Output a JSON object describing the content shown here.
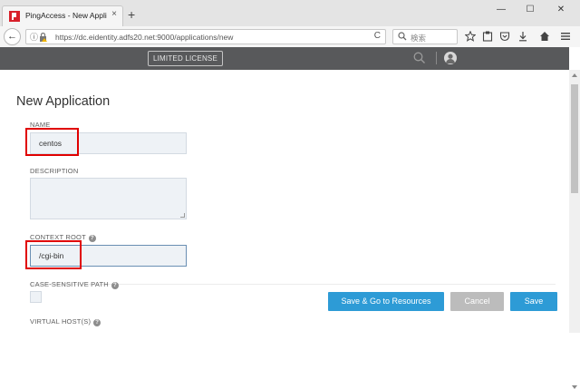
{
  "browser": {
    "tab_title": "PingAccess - New Applica...",
    "url": "https://dc.eidentity.adfs20.net:9000/applications/new",
    "search_placeholder": "検索",
    "tab_close": "×",
    "new_tab": "+",
    "win_min": "—",
    "win_max": "☐",
    "win_close": "✕",
    "back": "←",
    "info": "ⓘ",
    "reload": "C"
  },
  "app": {
    "license_label": "LIMITED LICENSE"
  },
  "form": {
    "title": "New Application",
    "name_label": "NAME",
    "name_value": "centos",
    "description_label": "DESCRIPTION",
    "context_root_label": "CONTEXT ROOT",
    "context_root_value": "/cgi-bin",
    "case_sensitive_label": "CASE-SENSITIVE PATH",
    "virtual_hosts_label": "VIRTUAL HOST(S)",
    "help_glyph": "?"
  },
  "actions": {
    "save_resources_label": "Save & Go to Resources",
    "cancel_label": "Cancel",
    "save_label": "Save"
  },
  "colors": {
    "app_header": "#58595b",
    "primary_button": "#2d9bd6",
    "cancel_button": "#bcbcbc",
    "highlight": "#e00000",
    "input_bg": "#eef2f6"
  }
}
